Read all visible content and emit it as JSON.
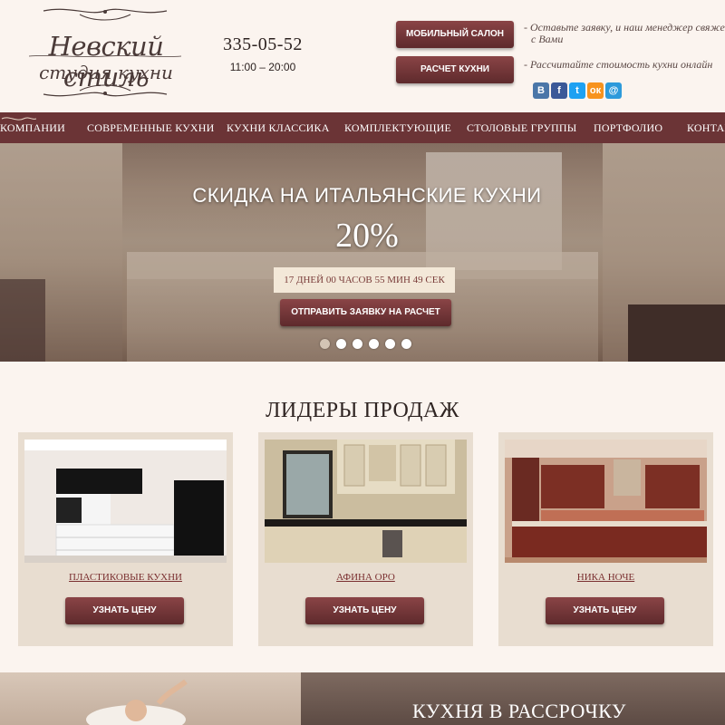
{
  "header": {
    "logo_line1": "Невский стиль",
    "logo_line2": "студия кухни",
    "phone": "335-05-52",
    "hours": "11:00 – 20:00",
    "btn_mobile": "МОБИЛЬНЫЙ САЛОН",
    "btn_calc": "РАСЧЕТ КУХНИ",
    "note1_line1": "- Оставьте заявку, и наш менеджер свяжется",
    "note1_line2": "с Вами",
    "note2": "- Рассчитайте стоимость кухни онлайн",
    "socials": [
      {
        "name": "vk-icon",
        "glyph": "B",
        "color": "#4a76a8"
      },
      {
        "name": "facebook-icon",
        "glyph": "f",
        "color": "#3b5998"
      },
      {
        "name": "twitter-icon",
        "glyph": "t",
        "color": "#1da1f2"
      },
      {
        "name": "odnoklassniki-icon",
        "glyph": "ок",
        "color": "#f7931e"
      },
      {
        "name": "mailru-icon",
        "glyph": "@",
        "color": "#2d9adb"
      }
    ]
  },
  "nav": {
    "items": [
      "КОМПАНИИ",
      "СОВРЕМЕННЫЕ КУХНИ",
      "КУХНИ КЛАССИКА",
      "КОМПЛЕКТУЮЩИЕ",
      "СТОЛОВЫЕ ГРУППЫ",
      "ПОРТФОЛИО",
      "КОНТАКТЫ"
    ]
  },
  "hero": {
    "title": "СКИДКА НА ИТАЛЬЯНСКИЕ КУХНИ",
    "percent": "20%",
    "countdown": "17 ДНЕЙ 00 ЧАСОВ 55 МИН 49 СЕК",
    "button": "ОТПРАВИТЬ ЗАЯВКУ НА РАСЧЕТ",
    "slide_count": 6,
    "active_slide": 1
  },
  "leaders": {
    "title": "ЛИДЕРЫ ПРОДАЖ",
    "cards": [
      {
        "name": "ПЛАСТИКОВЫЕ КУХНИ",
        "button": "УЗНАТЬ ЦЕНУ"
      },
      {
        "name": "АФИНА ОРО",
        "button": "УЗНАТЬ ЦЕНУ"
      },
      {
        "name": "НИКА НОЧЕ",
        "button": "УЗНАТЬ ЦЕНУ"
      }
    ]
  },
  "bottom": {
    "title": "КУХНЯ В РАССРОЧКУ"
  },
  "colors": {
    "brand": "#6b3436",
    "background": "#fbf4ef",
    "card": "#e8ddd0",
    "link": "#7a2f30"
  }
}
